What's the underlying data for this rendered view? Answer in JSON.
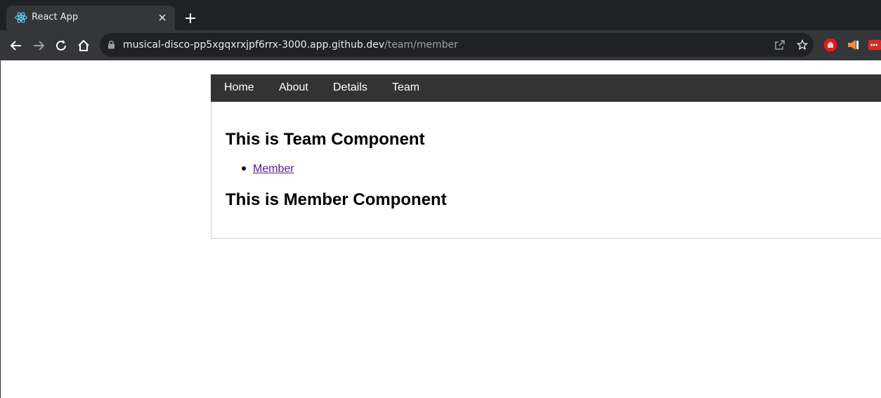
{
  "browser": {
    "tab": {
      "title": "React App",
      "favicon": "react-atom-icon"
    },
    "address": {
      "host": "musical-disco-pp5xgqxrxjpf6rrx-3000.app.github.dev",
      "path": "/team/member"
    },
    "icons": [
      "back-icon",
      "forward-icon",
      "reload-icon",
      "home-icon",
      "lock-icon",
      "share-icon",
      "star-icon",
      "adblock-icon",
      "extension-icon",
      "lastpass-icon"
    ],
    "colors": {
      "tabstrip": "#202124",
      "toolbar": "#35363a",
      "omnibox": "#202124"
    }
  },
  "app": {
    "nav": {
      "items": [
        "Home",
        "About",
        "Details",
        "Team"
      ]
    },
    "team_heading": "This is Team Component",
    "team_links": [
      "Member"
    ],
    "member_heading": "This is Member Component",
    "colors": {
      "nav_bg": "#333333",
      "nav_text": "#ffffff",
      "link_visited": "#551a8b"
    }
  }
}
